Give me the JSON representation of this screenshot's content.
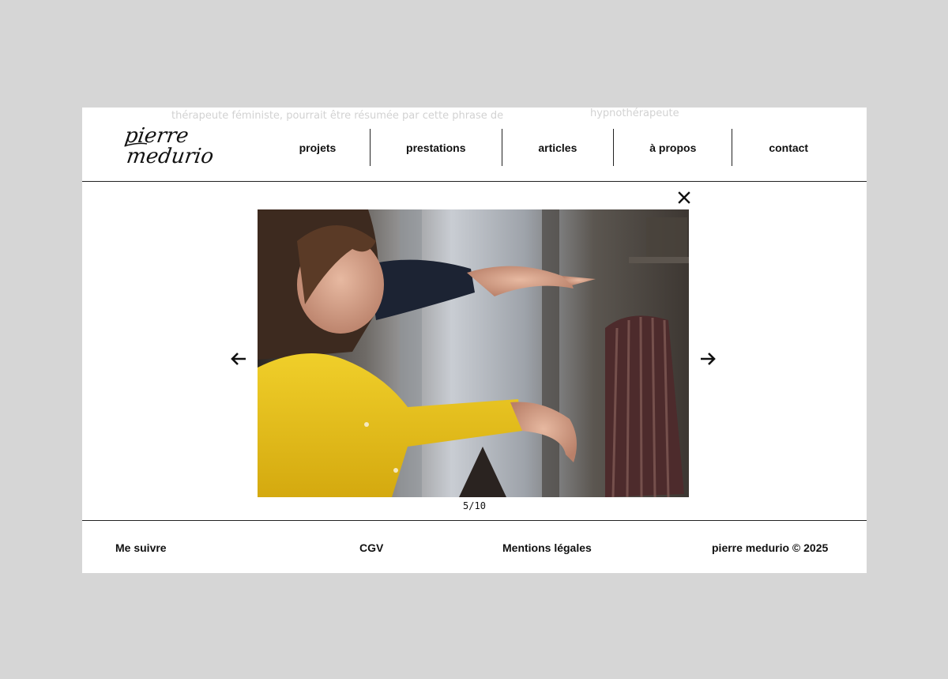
{
  "ghost_text": {
    "left": "thérapeute féministe, pourrait être résumée par cette phrase de",
    "right": "hypnothérapeute"
  },
  "logo": {
    "line1": "pierre",
    "line2": "medurio"
  },
  "nav": [
    {
      "label": "projets"
    },
    {
      "label": "prestations"
    },
    {
      "label": "articles"
    },
    {
      "label": "à propos"
    },
    {
      "label": "contact"
    }
  ],
  "lightbox": {
    "counter": "5/10",
    "close_icon": "close-icon",
    "prev_icon": "arrow-left-icon",
    "next_icon": "arrow-right-icon"
  },
  "footer": {
    "follow": "Me suivre",
    "cgv": "CGV",
    "legal": "Mentions légales",
    "copyright": "pierre medurio © 2025"
  },
  "colors": {
    "page_bg": "#d6d6d6",
    "panel_bg": "#ffffff",
    "text": "#111111",
    "rule": "#222222",
    "sweater_yellow": "#e8c21c"
  }
}
